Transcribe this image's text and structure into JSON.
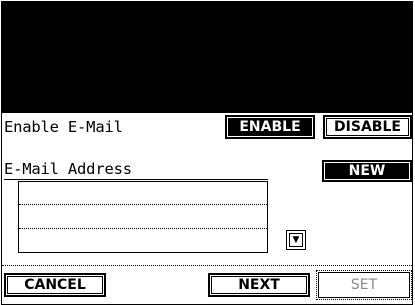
{
  "email_settings": {
    "enable_label": "Enable E-Mail",
    "enable_button": "ENABLE",
    "disable_button": "DISABLE",
    "address_label": "E-Mail Address",
    "new_button": "NEW",
    "address_lines": [
      "",
      "",
      ""
    ],
    "scroll_down_icon": "▼"
  },
  "footer": {
    "cancel_button": "CANCEL",
    "next_button": "NEXT",
    "set_button": "SET"
  }
}
